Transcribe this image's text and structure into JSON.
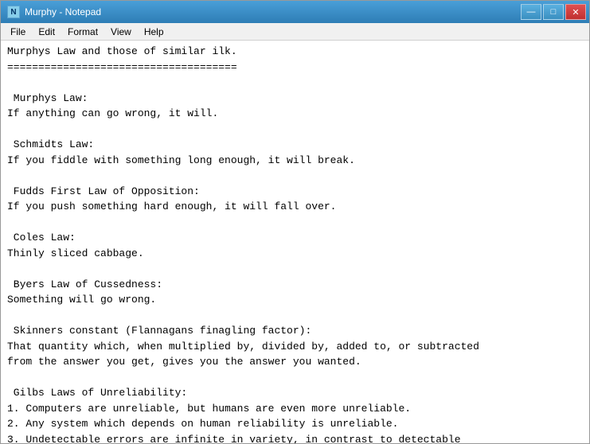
{
  "window": {
    "title": "Murphy - Notepad",
    "icon_label": "N"
  },
  "title_buttons": {
    "minimize": "—",
    "maximize": "□",
    "close": "✕"
  },
  "menu": {
    "items": [
      "File",
      "Edit",
      "Format",
      "View",
      "Help"
    ]
  },
  "editor": {
    "content": "Murphys Law and those of similar ilk.\n=====================================\n\n Murphys Law:\nIf anything can go wrong, it will.\n\n Schmidts Law:\nIf you fiddle with something long enough, it will break.\n\n Fudds First Law of Opposition:\nIf you push something hard enough, it will fall over.\n\n Coles Law:\nThinly sliced cabbage.\n\n Byers Law of Cussedness:\nSomething will go wrong.\n\n Skinners constant (Flannagans finagling factor):\nThat quantity which, when multiplied by, divided by, added to, or subtracted\nfrom the answer you get, gives you the answer you wanted.\n\n Gilbs Laws of Unreliability:\n1. Computers are unreliable, but humans are even more unreliable.\n2. Any system which depends on human reliability is unreliable.\n3. Undetectable errors are infinite in variety, in contrast to detectable"
  }
}
